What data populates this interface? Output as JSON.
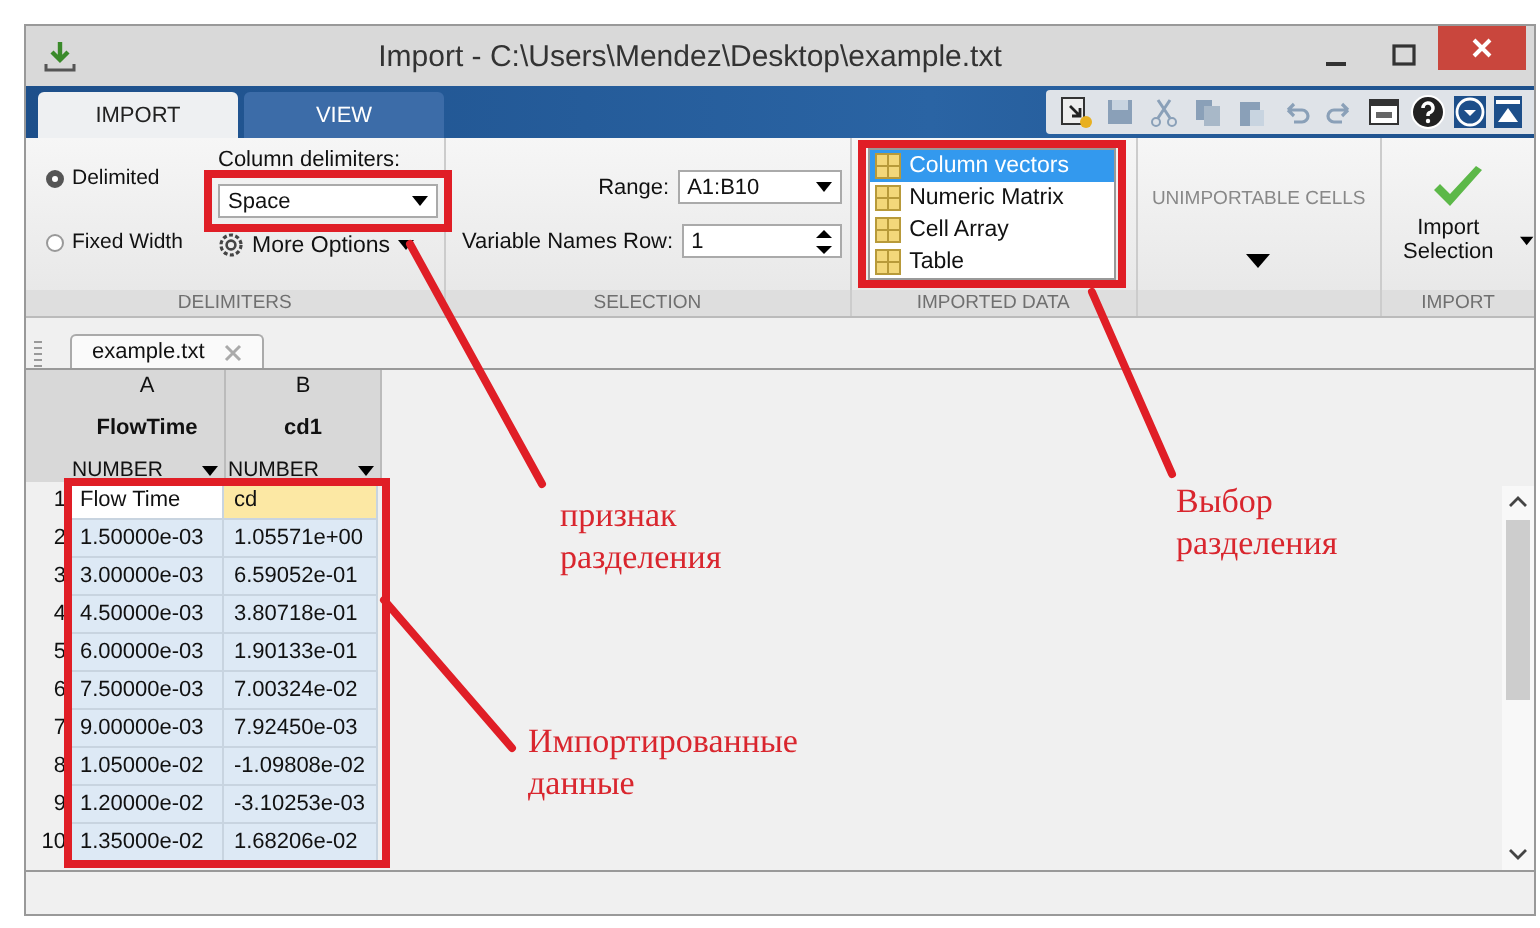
{
  "window": {
    "title": "Import - C:\\Users\\Mendez\\Desktop\\example.txt"
  },
  "tabs": [
    {
      "label": "IMPORT",
      "selected": true
    },
    {
      "label": "VIEW",
      "selected": false
    }
  ],
  "delimiters": {
    "section": "DELIMITERS",
    "modes": [
      {
        "label": "Delimited",
        "selected": true
      },
      {
        "label": "Fixed Width",
        "selected": false
      }
    ],
    "column_delimiters_label": "Column delimiters:",
    "column_delimiters_value": "Space",
    "more_options": "More Options"
  },
  "selection": {
    "section": "SELECTION",
    "range_label": "Range:",
    "range_value": "A1:B10",
    "names_row_label": "Variable Names Row:",
    "names_row_value": "1"
  },
  "imported_data": {
    "section": "IMPORTED DATA",
    "items": [
      {
        "label": "Column vectors",
        "selected": true
      },
      {
        "label": "Numeric Matrix",
        "selected": false
      },
      {
        "label": "Cell Array",
        "selected": false
      },
      {
        "label": "Table",
        "selected": false
      }
    ]
  },
  "unimportable": {
    "label": "UNIMPORTABLE CELLS"
  },
  "import": {
    "section": "IMPORT",
    "button": "Import Selection"
  },
  "document_tab": "example.txt",
  "table": {
    "columns": [
      {
        "letter": "A",
        "name": "FlowTime",
        "type": "NUMBER"
      },
      {
        "letter": "B",
        "name": "cd1",
        "type": "NUMBER"
      }
    ],
    "rows": [
      {
        "number": "1",
        "kind": "names",
        "cells": [
          "Flow Time",
          "cd"
        ]
      },
      {
        "number": "2",
        "kind": "data",
        "cells": [
          "1.50000e-03",
          "1.05571e+00"
        ]
      },
      {
        "number": "3",
        "kind": "data",
        "cells": [
          "3.00000e-03",
          "6.59052e-01"
        ]
      },
      {
        "number": "4",
        "kind": "data",
        "cells": [
          "4.50000e-03",
          "3.80718e-01"
        ]
      },
      {
        "number": "5",
        "kind": "data",
        "cells": [
          "6.00000e-03",
          "1.90133e-01"
        ]
      },
      {
        "number": "6",
        "kind": "data",
        "cells": [
          "7.50000e-03",
          "7.00324e-02"
        ]
      },
      {
        "number": "7",
        "kind": "data",
        "cells": [
          "9.00000e-03",
          "7.92450e-03"
        ]
      },
      {
        "number": "8",
        "kind": "data",
        "cells": [
          "1.05000e-02",
          "-1.09808e-02"
        ]
      },
      {
        "number": "9",
        "kind": "data",
        "cells": [
          "1.20000e-02",
          "-3.10253e-03"
        ]
      },
      {
        "number": "10",
        "kind": "data",
        "cells": [
          "1.35000e-02",
          "1.68206e-02"
        ]
      }
    ]
  },
  "annotations": [
    {
      "text": "признак\nразделения"
    },
    {
      "text": "Выбор\nразделения"
    },
    {
      "text": "Импортированные\nданные"
    }
  ]
}
